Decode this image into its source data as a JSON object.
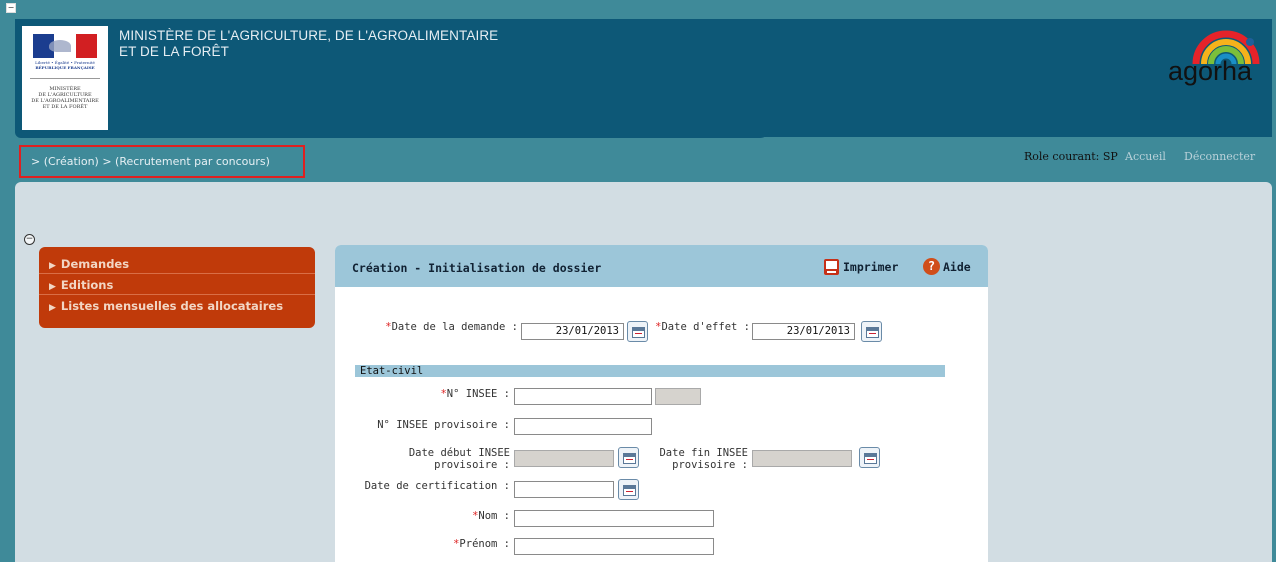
{
  "header": {
    "ministry_line1": "MINISTÈRE DE L'AGRICULTURE, DE L'AGROALIMENTAIRE",
    "ministry_line2": "ET DE LA FORÊT",
    "logo_motto_1": "Liberté • Égalité • Fraternité",
    "logo_motto_2": "RÉPUBLIQUE FRANÇAISE",
    "logo_ministry_1": "MINISTÈRE",
    "logo_ministry_2": "DE L'AGRICULTURE",
    "logo_ministry_3": "DE L'AGROALIMENTAIRE",
    "logo_ministry_4": "ET DE LA FORÊT",
    "app_name": "agorha",
    "role_label": "Role courant: SP",
    "home_link": "Accueil",
    "logout_link": "Déconnecter"
  },
  "breadcrumb": {
    "text": "> (Création)  > (Recrutement par concours)"
  },
  "menu": {
    "items": [
      {
        "label": "Demandes"
      },
      {
        "label": "Editions"
      },
      {
        "label": "Listes mensuelles des allocataires"
      }
    ]
  },
  "panel": {
    "title": "Création - Initialisation de dossier",
    "print_label": "Imprimer",
    "help_label": "Aide",
    "section_etat_civil": "Etat-civil",
    "fields": {
      "date_demande": {
        "label": "Date de la demande :",
        "value": "23/01/2013"
      },
      "date_effet": {
        "label": "Date d'effet :",
        "value": "23/01/2013"
      },
      "insee": {
        "label": "N° INSEE :",
        "value": ""
      },
      "insee_provisoire": {
        "label": "N° INSEE provisoire :",
        "value": ""
      },
      "date_debut_insee_1": "Date début INSEE",
      "date_debut_insee_2": "provisoire :",
      "date_fin_insee_1": "Date fin INSEE",
      "date_fin_insee_2": "provisoire :",
      "date_certification": {
        "label": "Date de certification :",
        "value": ""
      },
      "nom": {
        "label": "Nom :",
        "value": ""
      },
      "prenom": {
        "label": "Prénom :",
        "value": ""
      }
    },
    "required_marker": "*"
  },
  "colors": {
    "page_bg": "#3f8a99",
    "header_bg": "#0d5877",
    "menu_bg": "#c03a0a",
    "panel_head_bg": "#9cc6d9",
    "content_bg": "#d2dde3",
    "highlight_border": "#e02020"
  },
  "icons": {
    "pdf": "pdf-icon",
    "help": "help-icon",
    "calendar": "calendar-icon",
    "collapse": "collapse-icon"
  }
}
